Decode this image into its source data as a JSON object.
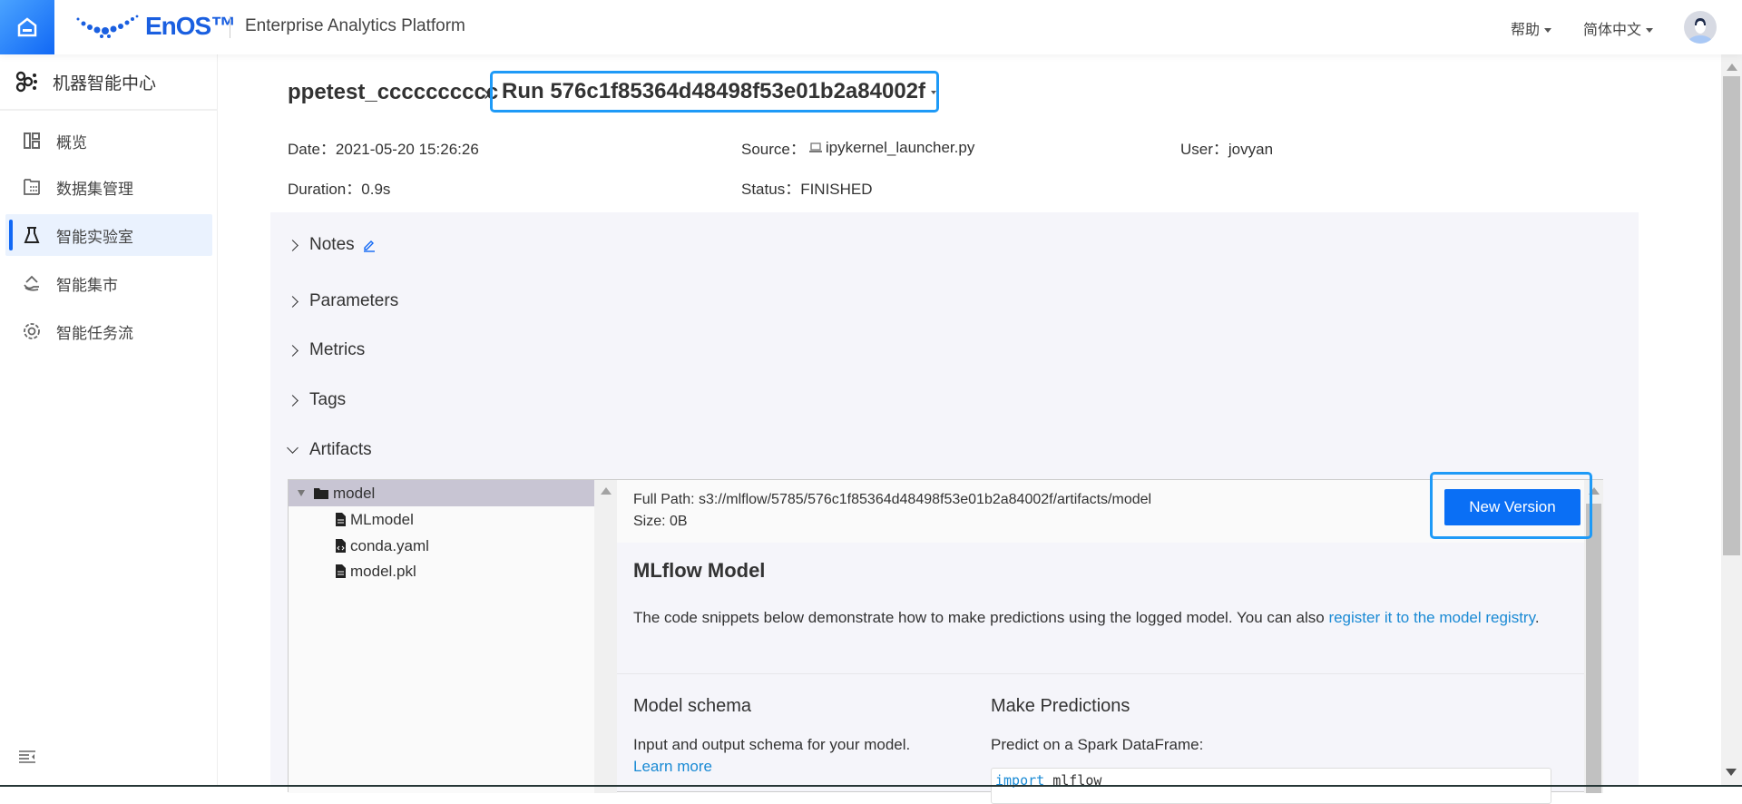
{
  "header": {
    "logo_text": "EnOS™",
    "app_title": "Enterprise Analytics Platform",
    "help_label": "帮助",
    "language_label": "简体中文",
    "brand_color": "#1168f5"
  },
  "sidebar": {
    "title": "机器智能中心",
    "items": [
      {
        "label": "概览",
        "icon": "dashboard-icon"
      },
      {
        "label": "数据集管理",
        "icon": "dataset-icon"
      },
      {
        "label": "智能实验室",
        "icon": "flask-icon",
        "active": true
      },
      {
        "label": "智能集市",
        "icon": "market-icon"
      },
      {
        "label": "智能任务流",
        "icon": "workflow-icon"
      }
    ]
  },
  "run": {
    "experiment": "ppetest_cccccccccc",
    "run_title": "Run 576c1f85364d48498f53e01b2a84002f",
    "date_label": "Date：",
    "date": "2021-05-20 15:26:26",
    "source_label": "Source：",
    "source": "ipykernel_launcher.py",
    "user_label": "User：",
    "user": "jovyan",
    "duration_label": "Duration：",
    "duration": "0.9s",
    "status_label": "Status：",
    "status": "FINISHED"
  },
  "sections": {
    "notes": "Notes",
    "parameters": "Parameters",
    "metrics": "Metrics",
    "tags": "Tags",
    "artifacts": "Artifacts"
  },
  "artifacts": {
    "tree": [
      {
        "name": "model",
        "type": "folder",
        "selected": true
      },
      {
        "name": "MLmodel",
        "type": "file"
      },
      {
        "name": "conda.yaml",
        "type": "code-file"
      },
      {
        "name": "model.pkl",
        "type": "file"
      }
    ],
    "full_path": "Full Path: s3://mlflow/5785/576c1f85364d48498f53e01b2a84002f/artifacts/model",
    "size": "Size: 0B",
    "new_version_label": "New Version",
    "model_heading": "MLflow Model",
    "desc_text": "The code snippets below demonstrate how to make predictions using the logged model. You can also ",
    "desc_link": "register it to the model registry",
    "desc_end": ".",
    "schema_heading": "Model schema",
    "schema_text": "Input and output schema for your model.",
    "learn_more": "Learn more",
    "predict_heading": "Make Predictions",
    "predict_text": "Predict on a Spark DataFrame:",
    "code_keyword": "import",
    "code_rest": " mlflow"
  }
}
